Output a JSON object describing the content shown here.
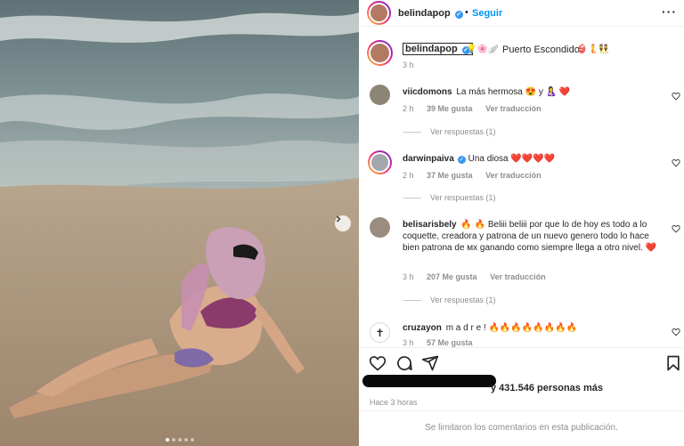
{
  "post": {
    "author": "belindapop",
    "follow_label": "Seguir",
    "caption_user": "belindapop",
    "caption_text": "Puerto Escondido",
    "caption_time": "3 h",
    "image": {
      "slide_count": 5,
      "active_slide": 1
    }
  },
  "comments": [
    {
      "user": "viicdomons",
      "text": "La más hermosa 😍 y 🤱 ❤️",
      "time": "2 h",
      "likes": "39 Me gusta",
      "translate": "Ver traducción",
      "replies": "Ver respuestas (1)"
    },
    {
      "user": "darwinpaiva",
      "verified": true,
      "text": "Una diosa ❤️❤️❤️❤️",
      "time": "2 h",
      "likes": "37 Me gusta",
      "translate": "Ver traducción",
      "replies": "Ver respuestas (1)"
    },
    {
      "user": "belisarisbely",
      "text": "🔥 🔥 Beliii beliii por que lo de hoy es todo a lo coquette, creadora y patrona de un nuevo genero todo lo hace bien patrona de мх ganando como siempre llega a otro nivel. ❤️",
      "time": "3 h",
      "likes": "207 Me gusta",
      "translate": "Ver traducción",
      "replies": "Ver respuestas (1)"
    },
    {
      "user": "cruzayon",
      "text": "m a d r e ! 🔥🔥🔥🔥🔥🔥🔥🔥",
      "time": "3 h",
      "likes": "57 Me gusta"
    }
  ],
  "footer": {
    "likes_text": "y 431.546 personas más",
    "posted_ago": "Hace 3 horas",
    "comments_limited": "Se limitaron los comentarios en esta publicación."
  },
  "icons": [
    "verified-icon",
    "more-icon",
    "heart-icon",
    "comment-icon",
    "share-icon",
    "bookmark-icon",
    "chevron-right-icon",
    "cross-icon"
  ],
  "colors": {
    "link": "#0095f6",
    "muted": "#8e8e8e",
    "verified": "#3897f0"
  }
}
